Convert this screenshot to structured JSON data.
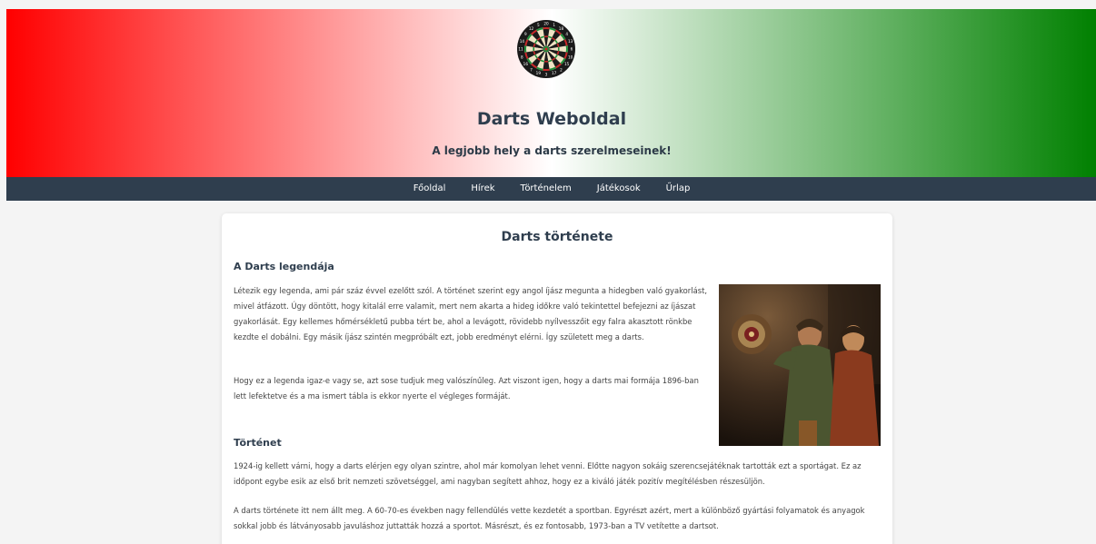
{
  "header": {
    "title": "Darts Weboldal",
    "subtitle": "A legjobb hely a darts szerelmeseinek!",
    "dartboard_numbers": [
      "20",
      "1",
      "18",
      "4",
      "13",
      "6",
      "10",
      "15",
      "2",
      "17",
      "3",
      "19",
      "7",
      "16",
      "8",
      "11",
      "14",
      "9",
      "12",
      "5"
    ],
    "gradient_colors": [
      "#ff0000",
      "#ffffff",
      "#008000"
    ]
  },
  "nav": {
    "items": [
      {
        "label": "Főoldal"
      },
      {
        "label": "Hírek"
      },
      {
        "label": "Történelem"
      },
      {
        "label": "Játékosok"
      },
      {
        "label": "Űrlap"
      }
    ]
  },
  "main": {
    "page_title": "Darts története",
    "sections": [
      {
        "heading": "A Darts legendája",
        "paragraphs": [
          "Létezik egy legenda, ami pár száz évvel ezelőtt szól. A történet szerint egy angol íjász megunta a hidegben való gyakorlást, mivel átfázott. Úgy döntött, hogy kitalál erre valamit, mert nem akarta a hideg időkre való tekintettel befejezni az íjászat gyakorlását. Egy kellemes hőmérsékletű pubba tért be, ahol a levágott, rövidebb nyílvesszőit egy falra akasztott rönkbe kezdte el dobálni. Egy másik íjász szintén megpróbált ezt, jobb eredményt elérni. Így született meg a darts.",
          "Hogy ez a legenda igaz-e vagy se, azt sose tudjuk meg valószínűleg. Azt viszont igen, hogy a darts mai formája 1896-ban lett lefektetve és a ma ismert tábla is ekkor nyerte el végleges formáját."
        ]
      },
      {
        "heading": "Történet",
        "paragraphs": [
          "1924-ig kellett várni, hogy a darts elérjen egy olyan szintre, ahol már komolyan lehet venni. Előtte nagyon sokáig szerencsejátéknak tartották ezt a sportágat. Ez az időpont egybe esik az első brit nemzeti szövetséggel, ami nagyban segített ahhoz, hogy ez a kiváló játék pozitív megítélésben részesüljön.",
          "A darts története itt nem állt meg. A 60-70-es években nagy fellendülés vette kezdetét a sportban. Egyrészt azért, mert a különböző gyártási folyamatok és anyagok sokkal jobb és látványosabb javuláshoz juttatták hozzá a sportot. Másrészt, és ez fontosabb, 1973-ban a TV vetítette a dartsot."
        ]
      }
    ]
  },
  "colors": {
    "nav_bg": "#2f3e4e",
    "page_bg": "#f4f4f4",
    "card_bg": "#ffffff"
  }
}
